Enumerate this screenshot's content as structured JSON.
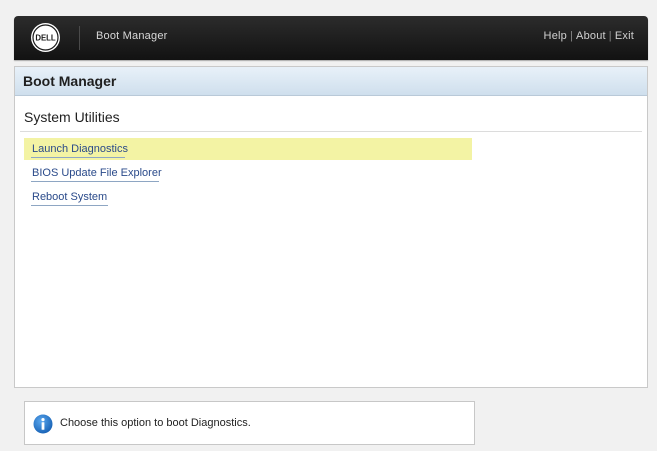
{
  "header": {
    "logo_text": "DELL",
    "title": "Boot Manager",
    "links": [
      "Help",
      "About",
      "Exit"
    ],
    "separator": "|"
  },
  "panel": {
    "title": "Boot Manager",
    "section_title": "System Utilities",
    "items": [
      {
        "label": "Launch Diagnostics",
        "selected": true
      },
      {
        "label": "BIOS Update File Explorer",
        "selected": false
      },
      {
        "label": "Reboot System",
        "selected": false
      }
    ]
  },
  "info": {
    "icon": "info-icon",
    "text": "Choose this option to boot Diagnostics."
  },
  "colors": {
    "header_bg": "#1a1a1a",
    "panel_header_bg": "#dbe7f3",
    "selected_bg": "#f3f3a4",
    "link_text": "#2a4a8a",
    "info_icon": "#1e6fc4"
  }
}
